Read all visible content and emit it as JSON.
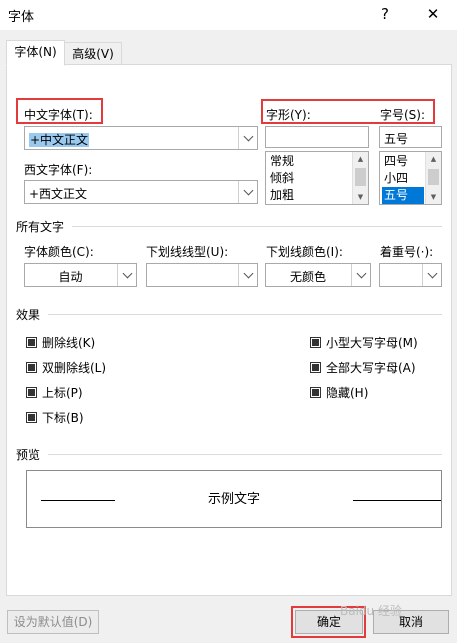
{
  "window": {
    "title": "字体",
    "help_icon": "?",
    "close_icon": "✕"
  },
  "tabs": [
    {
      "label": "字体(N)"
    },
    {
      "label": "高级(V)"
    }
  ],
  "chinese_font": {
    "label": "中文字体(T):",
    "value": "+中文正文"
  },
  "western_font": {
    "label": "西文字体(F):",
    "value": "+西文正文"
  },
  "font_style": {
    "label": "字形(Y):",
    "value": "",
    "options": [
      "常规",
      "倾斜",
      "加粗"
    ]
  },
  "font_size": {
    "label": "字号(S):",
    "value": "五号",
    "options": [
      "四号",
      "小四",
      "五号"
    ],
    "selected": "五号"
  },
  "all_text": {
    "section_label": "所有文字",
    "font_color": {
      "label": "字体颜色(C):",
      "value": "自动"
    },
    "underline_style": {
      "label": "下划线线型(U):",
      "value": ""
    },
    "underline_color": {
      "label": "下划线颜色(I):",
      "value": "无颜色"
    },
    "emphasis": {
      "label": "着重号(·):",
      "value": ""
    }
  },
  "effects": {
    "section_label": "效果",
    "left": [
      "删除线(K)",
      "双删除线(L)",
      "上标(P)",
      "下标(B)"
    ],
    "right": [
      "小型大写字母(M)",
      "全部大写字母(A)",
      "隐藏(H)"
    ]
  },
  "preview": {
    "section_label": "预览",
    "sample": "示例文字"
  },
  "buttons": {
    "set_default": "设为默认值(D)",
    "ok": "确定",
    "cancel": "取消"
  },
  "watermark": "Baidu 经验",
  "colors": {
    "highlight": "#e33b3b",
    "selection": "#0078d7"
  }
}
